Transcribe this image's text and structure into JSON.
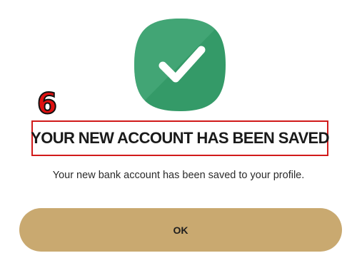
{
  "step_badge": "6",
  "dialog": {
    "title": "YOUR NEW ACCOUNT HAS BEEN SAVED",
    "message": "Your new bank account has been saved to your profile.",
    "ok_label": "OK"
  },
  "icons": {
    "success": "checkmark-icon"
  },
  "colors": {
    "success_green": "#349a68",
    "button_gold": "#c9a970",
    "annotation_red": "#d11a1a"
  }
}
